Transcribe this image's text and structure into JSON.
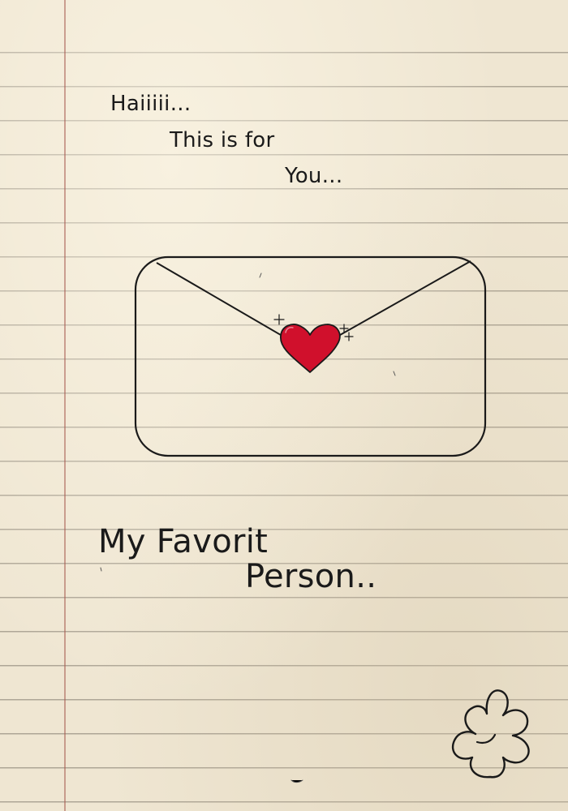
{
  "greeting": {
    "line1": "Haiiiii...",
    "line2": "This is for",
    "line3": "You..."
  },
  "closing": {
    "line1": "My Favorit",
    "line2": "Person.."
  },
  "icons": {
    "envelope": "envelope-icon",
    "heart": "heart-seal-icon",
    "sparkles": "sparkle-icon",
    "flower": "flower-doodle-icon"
  },
  "colors": {
    "paper": "#efe6d2",
    "ruled_line": "#787064",
    "margin_line": "#a85c52",
    "ink": "#1a1a1a",
    "heart": "#d0102c"
  }
}
